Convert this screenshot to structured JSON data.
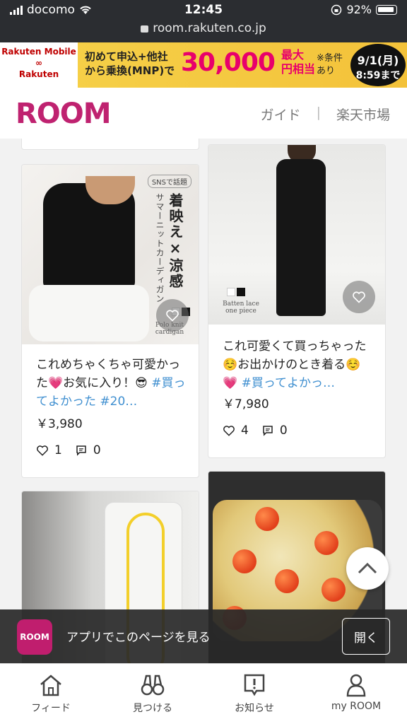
{
  "status_bar": {
    "carrier": "docomo",
    "time": "12:45",
    "battery": "92%",
    "url": "room.rakuten.co.jp"
  },
  "banner": {
    "logo_line1": "Rakuten Mobile",
    "logo_line2": "∞",
    "logo_line3": "Rakuten",
    "copy_line1": "初めて申込+他社",
    "copy_line2": "から乗換(MNP)で",
    "amount": "30,000",
    "unit_line1": "最大",
    "unit_line2": "円相当",
    "note_line1": "※条件",
    "note_line2": "あり",
    "date_line1": "9/1(月)",
    "date_line2": "8:59まで"
  },
  "header": {
    "logo": "ROOM",
    "nav_guide": "ガイド",
    "nav_separator": "|",
    "nav_ichiba": "楽天市場"
  },
  "cards": [
    {
      "image_badge": "SNSで話題",
      "image_title": "着映え×涼感",
      "image_subtitle": "サマーニットカーディガン",
      "image_caption": "Polo knit cardigan",
      "text_before_tag": "これめちゃくちゃ可愛かった💗お気に入り！😎",
      "tag_text": "#買ってよかった #20…",
      "price": "￥3,980",
      "likes": "1",
      "comments": "0"
    },
    {
      "image_caption": "Batten lace one piece",
      "text_before_tag": "これ可愛くて買っちゃった☺️お出かけのとき着る☺️💗",
      "tag_text": "#買ってよかっ…",
      "price": "￥7,980",
      "likes": "4",
      "comments": "0"
    }
  ],
  "app_banner": {
    "icon_label": "ROOM",
    "text": "アプリでこのページを見る",
    "open_label": "開く"
  },
  "bottom_nav": [
    {
      "label": "フィード",
      "icon": "home-icon"
    },
    {
      "label": "見つける",
      "icon": "binoculars-icon"
    },
    {
      "label": "お知らせ",
      "icon": "notification-icon"
    },
    {
      "label": "my ROOM",
      "icon": "user-icon"
    }
  ],
  "colors": {
    "brand": "#bf2270",
    "tag": "#3f8fd0",
    "banner_accent": "#e8006b"
  }
}
